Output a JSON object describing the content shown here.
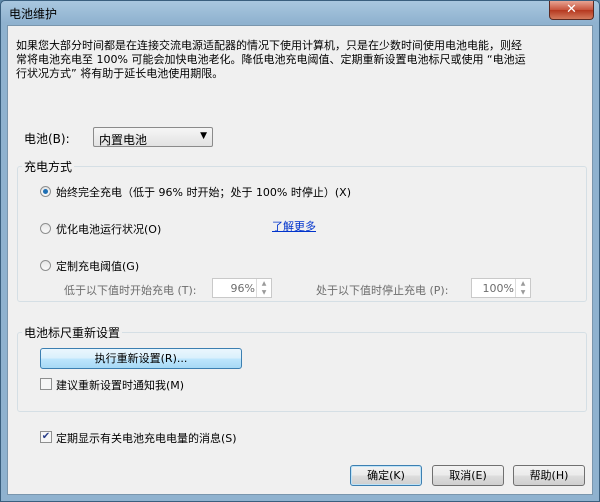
{
  "window": {
    "title": "电池维护",
    "close_glyph": "✕"
  },
  "intro": {
    "lines": [
      "如果您大部分时间都是在连接交流电源适配器的情况下使用计算机，只是在少数时间使用电池电能，则经",
      "常将电池充电至 100% 可能会加快电池老化。降低电池充电阈值、定期重新设置电池标尺或使用 “电池运",
      "行状况方式” 将有助于延长电池使用期限。"
    ]
  },
  "battery": {
    "label": "电池(B):",
    "selected": "内置电池"
  },
  "charge_mode": {
    "title": "充电方式",
    "options": [
      {
        "label": "始终完全充电（低于 96% 时开始；处于 100% 时停止）(X)",
        "selected": true
      },
      {
        "label": "优化电池运行状况(O)",
        "selected": false
      },
      {
        "label": "定制充电阈值(G)",
        "selected": false
      }
    ],
    "learn_more": "了解更多",
    "start_label": "低于以下值时开始充电 (T):",
    "start_value": "96%",
    "stop_label": "处于以下值时停止充电 (P):",
    "stop_value": "100%"
  },
  "calibration": {
    "title": "电池标尺重新设置",
    "execute_button": "执行重新设置(R)...",
    "notify_label": "建议重新设置时通知我(M)",
    "notify_checked": false
  },
  "show_messages": {
    "label": "定期显示有关电池充电电量的消息(S)",
    "checked": true,
    "check_glyph": "✔"
  },
  "buttons": {
    "ok": "确定(K)",
    "cancel": "取消(E)",
    "help": "帮助(H)"
  },
  "icons": {
    "combo_arrow": "▼",
    "spin_up": "▲",
    "spin_down": "▼"
  }
}
